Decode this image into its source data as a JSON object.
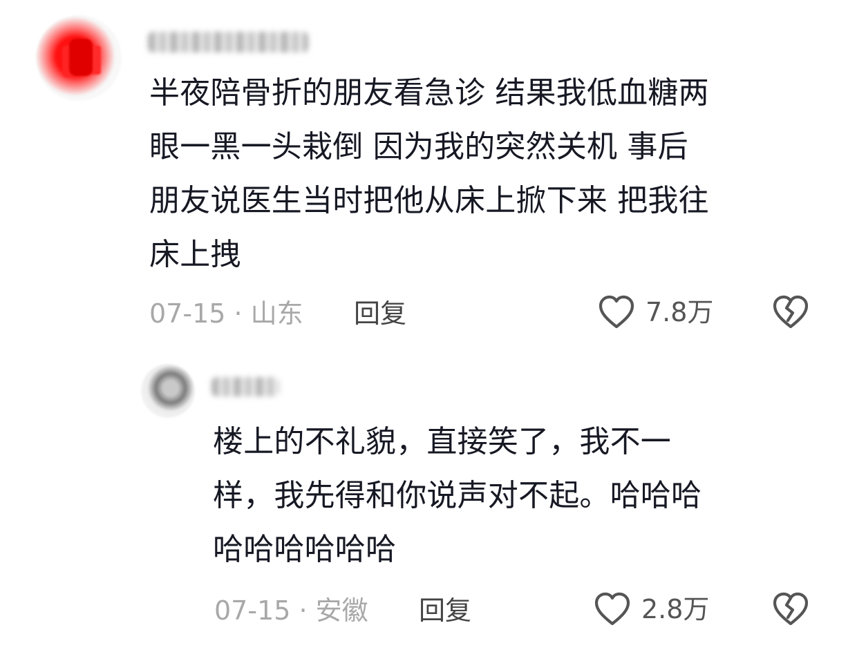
{
  "comments": [
    {
      "text": "半夜陪骨折的朋友看急诊 结果我低血糖两\n眼一黑一头栽倒 因为我的突然关机  事后\n朋友说医生当时把他从床上掀下来 把我往\n床上拽",
      "meta": "07-15 · 山东",
      "reply_label": "回复",
      "likes": "7.8万"
    }
  ],
  "replies": [
    {
      "text": "楼上的不礼貌，直接笑了，我不一\n样，我先得和你说声对不起。哈哈哈\n哈哈哈哈哈哈",
      "meta": "07-15 · 安徽",
      "reply_label": "回复",
      "likes": "2.8万"
    }
  ],
  "icons": {
    "like": "heart-outline-icon",
    "dislike": "broken-heart-icon"
  },
  "colors": {
    "text": "#161823",
    "meta": "#a8a8a8",
    "icon": "#555555"
  }
}
